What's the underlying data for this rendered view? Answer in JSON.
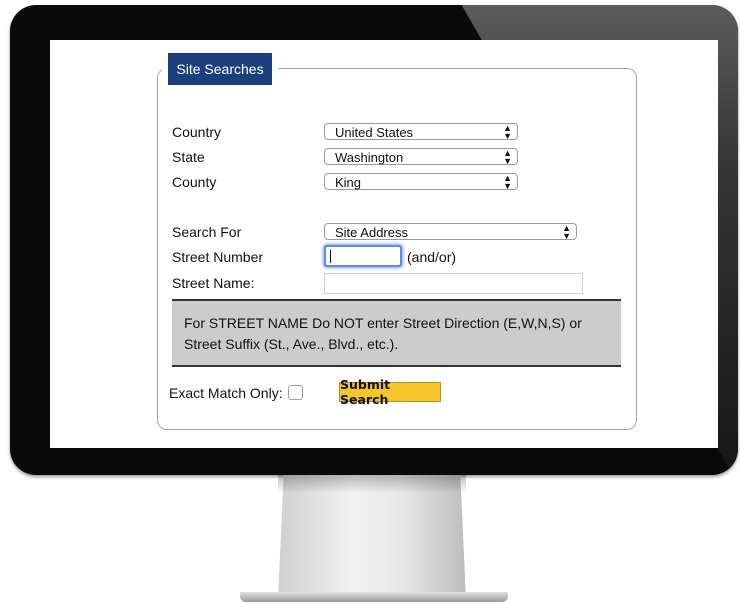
{
  "form": {
    "legend": "Site Searches",
    "country": {
      "label": "Country",
      "value": "United States"
    },
    "state": {
      "label": "State",
      "value": "Washington"
    },
    "county": {
      "label": "County",
      "value": "King"
    },
    "search_for": {
      "label": "Search For",
      "value": "Site Address"
    },
    "street_number": {
      "label": "Street Number",
      "value": "",
      "suffix": "(and/or)"
    },
    "street_name": {
      "label": "Street Name:",
      "value": ""
    },
    "note": "For STREET NAME Do NOT enter Street Direction (E,W,N,S) or Street Suffix (St., Ave., Blvd., etc.).",
    "exact_match": {
      "label": "Exact Match Only:",
      "checked": false
    },
    "submit_label": "Submit Search"
  },
  "colors": {
    "legend_bg": "#1b3f7c",
    "submit_bg": "#f5c52a",
    "note_bg": "#cccccc",
    "focus_ring": "#5b8ee6"
  }
}
